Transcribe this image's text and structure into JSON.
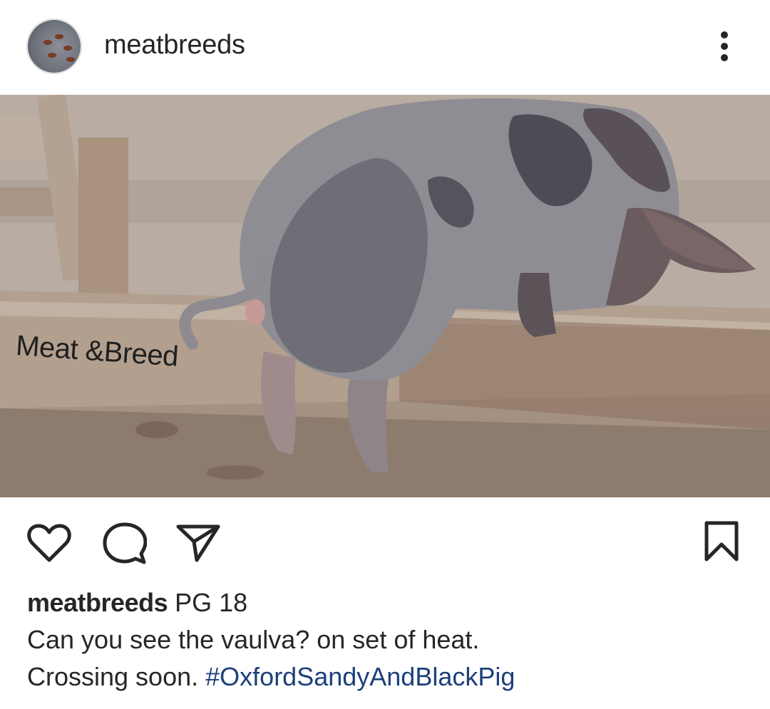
{
  "post": {
    "username": "meatbreeds",
    "image_watermark": "Meat &Breed",
    "caption": {
      "username": "meatbreeds",
      "first_line_text": "PG 18",
      "second_line_text": "Can you see the vaulva? on set of heat.",
      "third_line_text": "Crossing soon.",
      "hashtag": "#OxfordSandyAndBlackPig"
    }
  },
  "icons": {
    "more": "more-vertical-icon",
    "like": "heart-icon",
    "comment": "comment-icon",
    "share": "send-icon",
    "save": "bookmark-icon"
  },
  "colors": {
    "text": "#262626",
    "hashtag": "#1d3f7a",
    "background": "#ffffff"
  }
}
